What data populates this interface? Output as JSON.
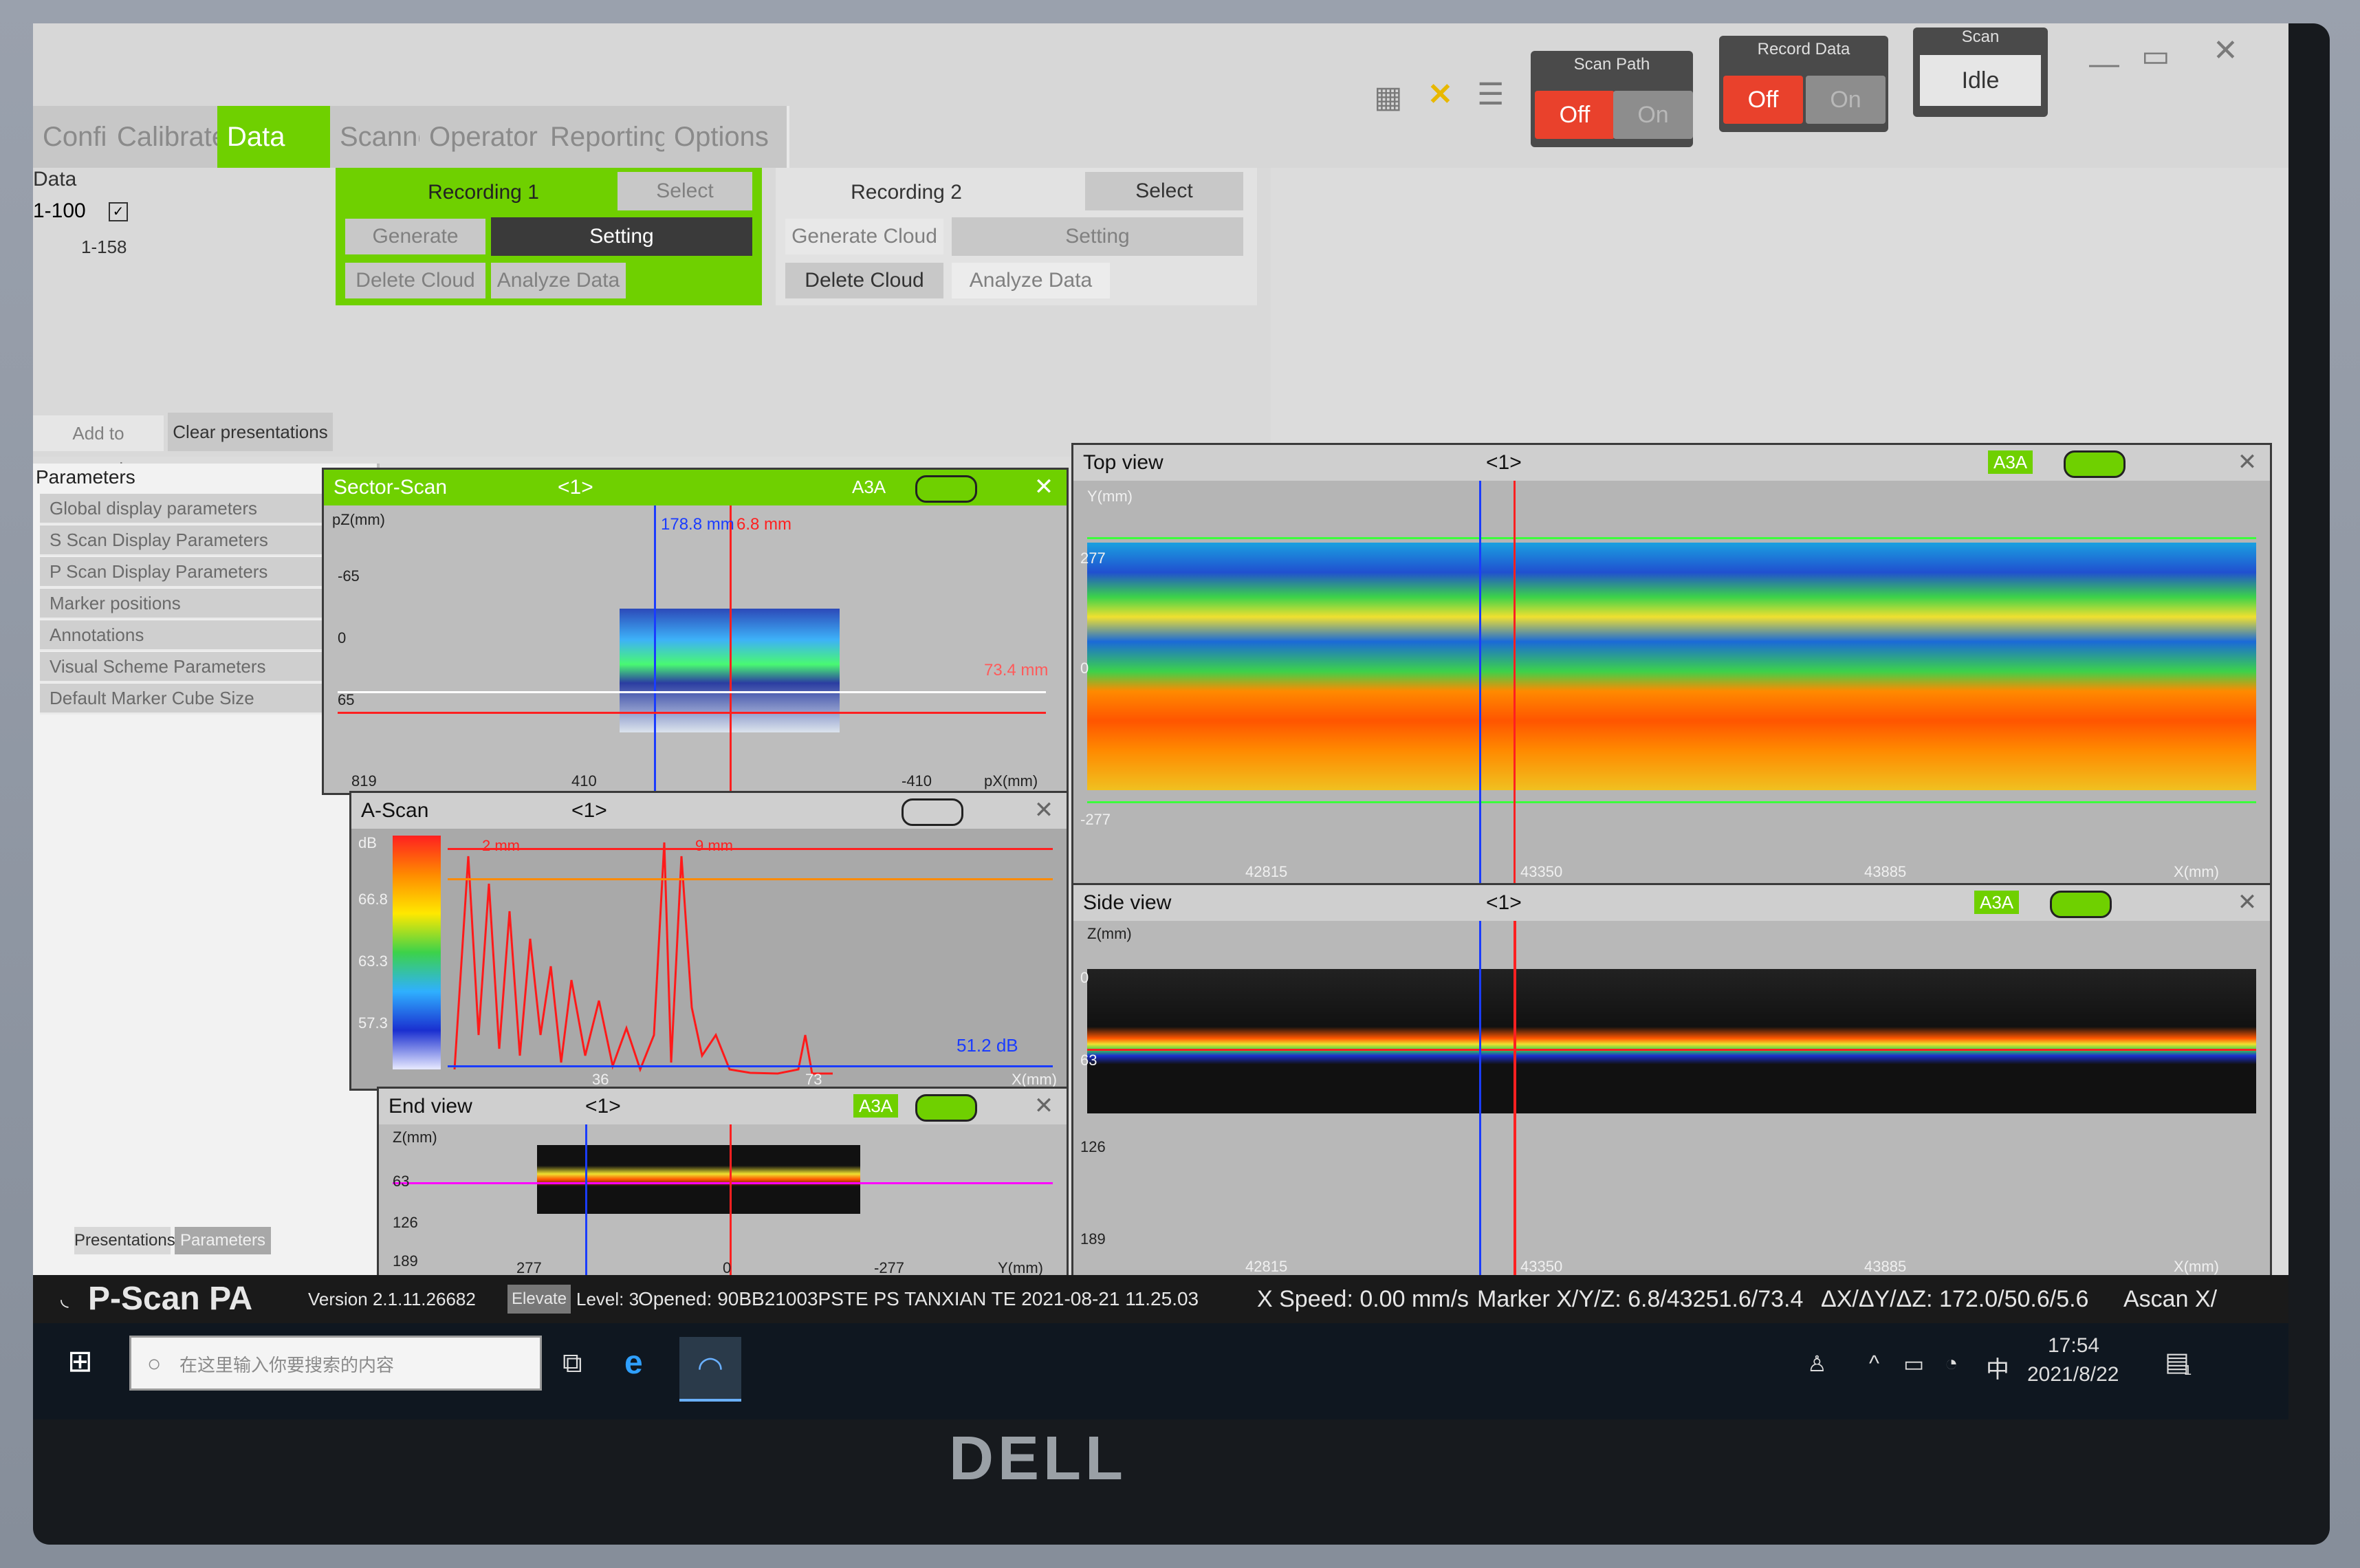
{
  "window": {
    "scan_path_label": "Scan Path",
    "record_data_label": "Record Data",
    "off_label": "Off",
    "on_label": "On",
    "scan_label": "Scan",
    "idle_label": "Idle"
  },
  "tabs": [
    {
      "label": "Config",
      "active": false
    },
    {
      "label": "Calibrate",
      "active": false
    },
    {
      "label": "Data View",
      "active": true
    },
    {
      "label": "Scanner",
      "active": false
    },
    {
      "label": "Operator",
      "active": false
    },
    {
      "label": "Reporting",
      "active": false
    },
    {
      "label": "Options",
      "active": false
    }
  ],
  "recordings": {
    "recording1": {
      "title": "Recording 1",
      "select": "Select",
      "generate": "Generate Cloud",
      "setting": "Setting",
      "delete": "Delete Cloud",
      "analyze": "Analyze Data"
    },
    "recording2": {
      "title": "Recording 2",
      "select": "Select",
      "generate": "Generate Cloud",
      "setting": "Setting",
      "delete": "Delete Cloud",
      "analyze": "Analyze Data"
    }
  },
  "data_list": {
    "header": "Data",
    "item1": "1-100",
    "item2": "1-158"
  },
  "presentation_buttons": {
    "add": "Add to presentations",
    "clear": "Clear presentations"
  },
  "parameters": {
    "header": "Parameters",
    "items": [
      "Global display parameters",
      "S Scan Display Parameters",
      "P Scan Display Parameters",
      "Marker positions",
      "Annotations",
      "Visual Scheme Parameters",
      "Default Marker Cube Size"
    ],
    "tab_presentations": "Presentations",
    "tab_parameters": "Parameters"
  },
  "views": {
    "sector": {
      "title": "Sector-Scan",
      "nav": "<1>",
      "a3a": "A3A",
      "ylabel": "pZ(mm)",
      "xlabel": "pX(mm)",
      "marker_blue": "178.8 mm",
      "marker_red": "6.8 mm",
      "depth_readout": "73.4 mm",
      "ticks_y": [
        "-65",
        "0",
        "65"
      ],
      "ticks_x": [
        "819",
        "410",
        "-410"
      ]
    },
    "ascan": {
      "title": "A-Scan",
      "nav": "<1>",
      "ylabel": "dB",
      "xlabel": "X(mm)",
      "marker_blue": "2 mm",
      "marker_red": "9 mm",
      "gain_readout": "51.2 dB",
      "ticks_y": [
        "66.8",
        "63.3",
        "57.3"
      ],
      "ticks_x": [
        "36",
        "73"
      ]
    },
    "end": {
      "title": "End view",
      "nav": "<1>",
      "a3a": "A3A",
      "ylabel": "Z(mm)",
      "xlabel": "Y(mm)",
      "ticks_y": [
        "63",
        "126",
        "189"
      ],
      "ticks_x": [
        "277",
        "0",
        "-277"
      ]
    },
    "top": {
      "title": "Top view",
      "nav": "<1>",
      "a3a": "A3A",
      "ylabel": "Y(mm)",
      "xlabel": "X(mm)",
      "ticks_y": [
        "277",
        "0",
        "-277"
      ],
      "ticks_x": [
        "42815",
        "43350",
        "43885"
      ]
    },
    "side": {
      "title": "Side view",
      "nav": "<1>",
      "a3a": "A3A",
      "ylabel": "Z(mm)",
      "xlabel": "X(mm)",
      "ticks_y": [
        "0",
        "63",
        "126",
        "189"
      ],
      "ticks_x": [
        "42815",
        "43350",
        "43885"
      ]
    }
  },
  "status": {
    "app_name": "P-Scan PA",
    "version": "Version 2.1.11.26682",
    "elevate": "Elevate",
    "level": "Level: 3",
    "opened": "Opened: 90BB21003PSTE PS TANXIAN TE 2021-08-21 11.25.03",
    "speed": "X Speed: 0.00 mm/s",
    "marker": "Marker X/Y/Z: 6.8/43251.6/73.4",
    "delta": "ΔX/ΔY/ΔZ: 172.0/50.6/5.6",
    "ascan": "Ascan X/"
  },
  "taskbar": {
    "search_placeholder": "在这里输入你要搜索的内容",
    "ime": "中",
    "time": "17:54",
    "date": "2021/8/22",
    "notifications": "1"
  },
  "brand": "DELL",
  "colors": {
    "accent": "#6fd000",
    "off_red": "#e9412c",
    "marker_blue": "#1a3cff",
    "marker_red": "#ff2020"
  }
}
